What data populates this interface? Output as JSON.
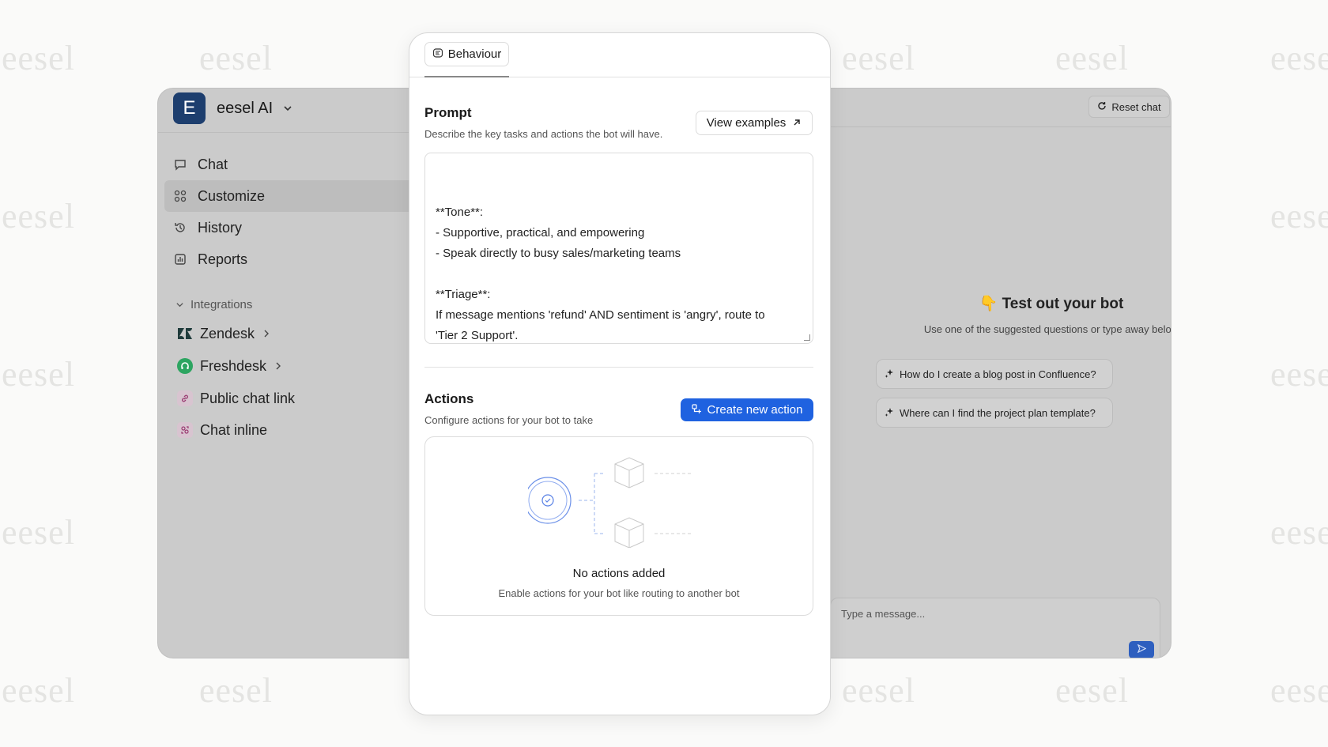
{
  "watermark": "eesel",
  "app": {
    "org_initial": "E",
    "org_name": "eesel AI",
    "nav": [
      {
        "label": "Chat",
        "icon": "chat-bubble-icon",
        "active": false
      },
      {
        "label": "Customize",
        "icon": "customize-grid-icon",
        "active": true
      },
      {
        "label": "History",
        "icon": "history-icon",
        "active": false
      },
      {
        "label": "Reports",
        "icon": "reports-icon",
        "active": false
      }
    ],
    "integrations_label": "Integrations",
    "integrations": [
      {
        "label": "Zendesk",
        "icon": "zendesk-icon",
        "has_submenu": true
      },
      {
        "label": "Freshdesk",
        "icon": "freshdesk-icon",
        "has_submenu": true
      },
      {
        "label": "Public chat link",
        "icon": "link-icon",
        "has_submenu": false
      },
      {
        "label": "Chat inline",
        "icon": "chat-inline-icon",
        "has_submenu": false
      }
    ]
  },
  "chat_preview": {
    "reset_label": "Reset chat",
    "title": "👇 Test out your bot",
    "subtitle": "Use one of the suggested questions or type away below",
    "suggestions": [
      "How do I create a blog post in Confluence?",
      "Where can I find the project plan template?"
    ],
    "input_placeholder": "Type a message..."
  },
  "panel": {
    "tab_label": "Behaviour",
    "prompt": {
      "title": "Prompt",
      "subtitle": "Describe the key tasks and actions the bot will have.",
      "view_examples_label": "View examples",
      "value": "**Tone**:\n- Supportive, practical, and empowering\n- Speak directly to busy sales/marketing teams\n\n**Triage**:\nIf message mentions 'refund' AND sentiment is 'angry', route to\n'Tier 2 Support'."
    },
    "actions": {
      "title": "Actions",
      "subtitle": "Configure actions for your bot to take",
      "create_label": "Create new action",
      "empty_title": "No actions added",
      "empty_subtitle": "Enable actions for your bot like routing to another bot"
    }
  },
  "colors": {
    "accent": "#1f62e0",
    "brand_logo": "#1d3e6e",
    "overlay_gray": "#cbcbcb"
  }
}
